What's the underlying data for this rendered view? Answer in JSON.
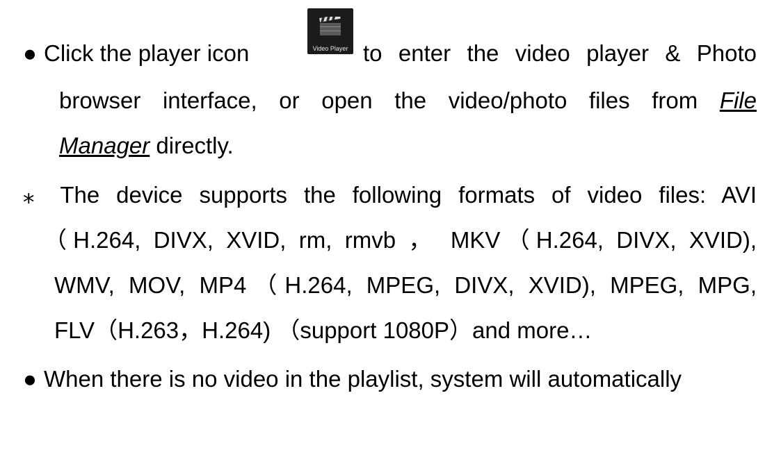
{
  "paragraph1": {
    "text_before_icon": "Click the player icon",
    "icon_label": "Video Player",
    "text_after_icon": "to enter the video player & Photo",
    "line2_text": "browser interface, or open the video/photo files from",
    "link_file": "File",
    "link_manager": "Manager",
    "line3_tail": "directly."
  },
  "note": {
    "marker": "⁎",
    "line1": "The device supports the following formats of video files: AVI",
    "line2": "（H.264, DIVX, XVID, rm, rmvb ， MKV（H.264, DIVX, XVID),",
    "line3": "WMV, MOV, MP4（H.264, MPEG, DIVX, XVID), MPEG, MPG,",
    "line4": "FLV（H.263，H.264) （support 1080P）and more…"
  },
  "paragraph2": {
    "line1": "When there is no video in the playlist, system will automatically"
  }
}
